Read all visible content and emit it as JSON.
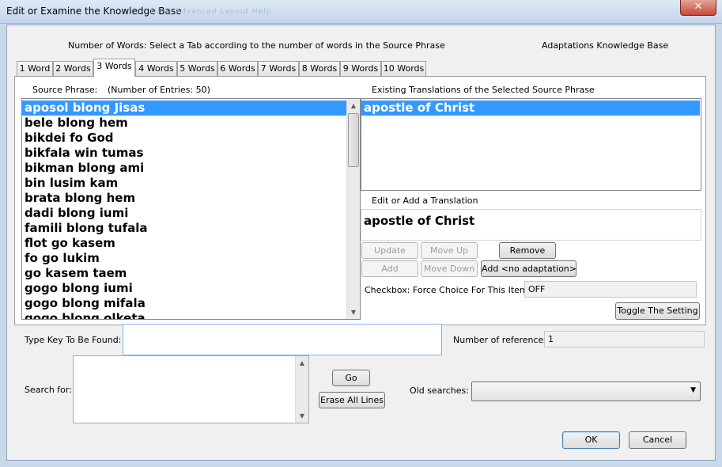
{
  "window": {
    "title": "Edit or Examine the Knowledge Base",
    "close_glyph": "✕",
    "ghost_menu": "Filter     Advanced     Layout     Help"
  },
  "header": {
    "instruction": "Number of Words: Select a Tab according to the number of words in the Source Phrase",
    "kb_type": "Adaptations Knowledge Base"
  },
  "tabs": [
    {
      "label": "1 Word"
    },
    {
      "label": "2 Words"
    },
    {
      "label": "3 Words",
      "active": true
    },
    {
      "label": "4 Words"
    },
    {
      "label": "5 Words"
    },
    {
      "label": "6 Words"
    },
    {
      "label": "7 Words"
    },
    {
      "label": "8 Words"
    },
    {
      "label": "9 Words"
    },
    {
      "label": "10 Words"
    }
  ],
  "source": {
    "label": "Source Phrase:",
    "entries_label": "(Number of Entries: 50)",
    "selected_index": 0,
    "items": [
      "aposol blong Jisas",
      "bele blong hem",
      "bikdei fo God",
      "bikfala win tumas",
      "bikman blong ami",
      "bin lusim kam",
      "brata blong hem",
      "dadi blong iumi",
      "famili blong tufala",
      "flot go kasem",
      "fo go lukim",
      "go kasem taem",
      "gogo blong iumi",
      "gogo blong mifala",
      "gogo blong olketa"
    ]
  },
  "translations": {
    "label": "Existing Translations of the Selected Source Phrase",
    "items": [
      "apostle of Christ"
    ],
    "selected_index": 0
  },
  "edit": {
    "label": "Edit or Add a Translation",
    "value": "apostle of Christ"
  },
  "buttons": {
    "update": "Update",
    "move_up": "Move Up",
    "remove": "Remove",
    "add": "Add",
    "move_down": "Move Down",
    "add_no_adaptation": "Add <no adaptation>",
    "toggle": "Toggle The Setting",
    "go": "Go",
    "erase": "Erase All Lines",
    "ok": "OK",
    "cancel": "Cancel"
  },
  "force_choice": {
    "label": "Checkbox: Force Choice For This Item is",
    "value": "OFF"
  },
  "search": {
    "key_label": "Type Key To Be Found:",
    "key_value": "",
    "refs_label": "Number of references:",
    "refs_value": "1",
    "search_for_label": "Search for:",
    "old_searches_label": "Old searches:",
    "old_searches_value": ""
  }
}
